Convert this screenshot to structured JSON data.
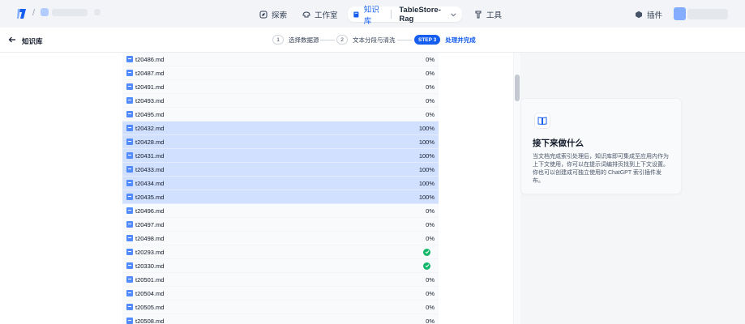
{
  "topbar": {
    "nav": [
      {
        "label": "探索",
        "icon": "compass-icon"
      },
      {
        "label": "工作室",
        "icon": "studio-icon"
      },
      {
        "label": "知识库",
        "icon": "book-icon",
        "active": true
      },
      {
        "label": "工具",
        "icon": "tool-icon"
      }
    ],
    "dataset_name": "TableStore-Rag",
    "plugin_label": "插件"
  },
  "subbar": {
    "back_label": "知识库",
    "steps": [
      {
        "num": "1",
        "label": "选择数据源"
      },
      {
        "num": "2",
        "label": "文本分段与清洗"
      },
      {
        "num": "STEP 3",
        "label": "处理并完成",
        "active": true
      }
    ]
  },
  "files": [
    {
      "name": "t20486.md",
      "progress": "0%",
      "status": "pending"
    },
    {
      "name": "t20487.md",
      "progress": "0%",
      "status": "pending"
    },
    {
      "name": "t20491.md",
      "progress": "0%",
      "status": "pending"
    },
    {
      "name": "t20493.md",
      "progress": "0%",
      "status": "pending"
    },
    {
      "name": "t20495.md",
      "progress": "0%",
      "status": "pending"
    },
    {
      "name": "t20432.md",
      "progress": "100%",
      "status": "done"
    },
    {
      "name": "t20428.md",
      "progress": "100%",
      "status": "done"
    },
    {
      "name": "t20431.md",
      "progress": "100%",
      "status": "done"
    },
    {
      "name": "t20433.md",
      "progress": "100%",
      "status": "done"
    },
    {
      "name": "t20434.md",
      "progress": "100%",
      "status": "done"
    },
    {
      "name": "t20435.md",
      "progress": "100%",
      "status": "done"
    },
    {
      "name": "t20496.md",
      "progress": "0%",
      "status": "pending"
    },
    {
      "name": "t20497.md",
      "progress": "0%",
      "status": "pending"
    },
    {
      "name": "t20498.md",
      "progress": "0%",
      "status": "pending"
    },
    {
      "name": "t20293.md",
      "progress": "",
      "status": "completed"
    },
    {
      "name": "t20330.md",
      "progress": "",
      "status": "completed"
    },
    {
      "name": "t20501.md",
      "progress": "0%",
      "status": "pending"
    },
    {
      "name": "t20504.md",
      "progress": "0%",
      "status": "pending"
    },
    {
      "name": "t20505.md",
      "progress": "0%",
      "status": "pending"
    },
    {
      "name": "t20508.md",
      "progress": "0%",
      "status": "pending"
    }
  ],
  "next_card": {
    "title": "接下来做什么",
    "text": "当文档完成索引处理后，知识库即可集成至应用内作为上下文使用，你可以在提示词编排页找到上下文设置。你也可以创建成可独立使用的 ChatGPT 索引插件发布。"
  },
  "colors": {
    "accent": "#155eef",
    "done_row": "#d1e0ff",
    "success": "#12b76a"
  }
}
